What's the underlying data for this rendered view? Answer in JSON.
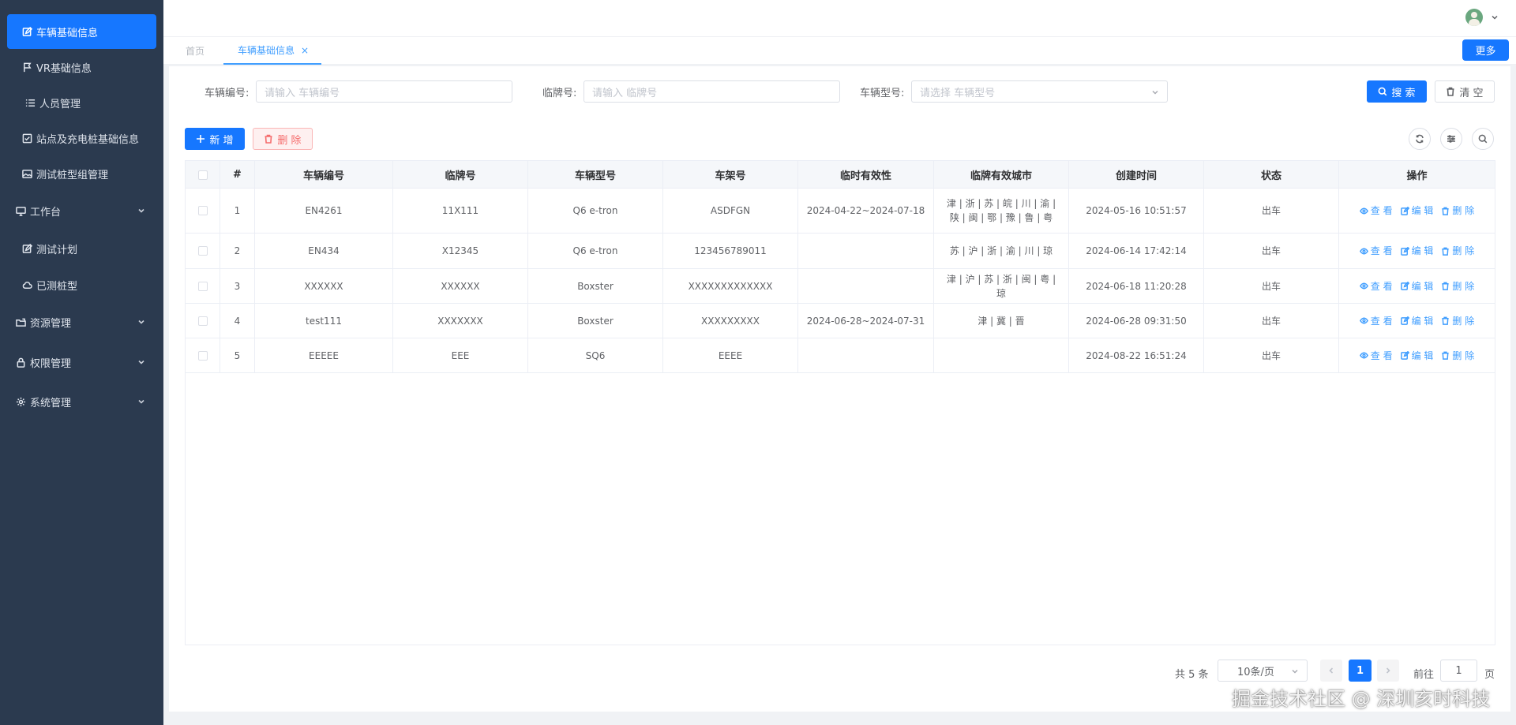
{
  "sidebar": {
    "items": [
      {
        "label": "车辆基础信息",
        "icon": "edit-icon",
        "active": true
      },
      {
        "label": "VR基础信息",
        "icon": "flag-icon"
      },
      {
        "label": "人员管理",
        "icon": "list-icon"
      },
      {
        "label": "站点及充电桩基础信息",
        "icon": "checkbox-icon"
      },
      {
        "label": "测试桩型组管理",
        "icon": "image-icon"
      },
      {
        "label": "工作台",
        "icon": "monitor-icon",
        "expandable": true
      },
      {
        "label": "测试计划",
        "icon": "edit-icon"
      },
      {
        "label": "已测桩型",
        "icon": "cloud-icon"
      },
      {
        "label": "资源管理",
        "icon": "folder-icon",
        "expandable": true
      },
      {
        "label": "权限管理",
        "icon": "lock-icon",
        "expandable": true
      },
      {
        "label": "系统管理",
        "icon": "gear-icon",
        "expandable": true
      }
    ]
  },
  "tabs": {
    "home": "首页",
    "active": "车辆基础信息",
    "close": "×",
    "more": "更多"
  },
  "filters": {
    "vehicle_no": {
      "label": "车辆编号:",
      "placeholder": "请输入 车辆编号"
    },
    "plate": {
      "label": "临牌号:",
      "placeholder": "请输入 临牌号"
    },
    "model": {
      "label": "车辆型号:",
      "placeholder": "请选择 车辆型号"
    },
    "search": "搜 索",
    "clear": "清 空"
  },
  "toolbar": {
    "add": "新 增",
    "delete": "删 除"
  },
  "table": {
    "headers": [
      "#",
      "车辆编号",
      "临牌号",
      "车辆型号",
      "车架号",
      "临时有效性",
      "临牌有效城市",
      "创建时间",
      "状态",
      "操作"
    ],
    "rows": [
      {
        "idx": "1",
        "vehicle_no": "EN4261",
        "plate": "11X111",
        "model": "Q6 e-tron",
        "vin": "ASDFGN",
        "validity": "2024-04-22~2024-07-18",
        "cities": "津 | 浙 | 苏 | 皖 | 川 | 渝 | 陕 | 闽 | 鄂 | 豫 | 鲁 | 粤",
        "created": "2024-05-16 10:51:57",
        "status": "出车"
      },
      {
        "idx": "2",
        "vehicle_no": "EN434",
        "plate": "X12345",
        "model": "Q6 e-tron",
        "vin": "123456789011",
        "validity": "",
        "cities": "苏 | 沪 | 浙 | 渝 | 川 | 琼",
        "created": "2024-06-14 17:42:14",
        "status": "出车"
      },
      {
        "idx": "3",
        "vehicle_no": "XXXXXX",
        "plate": "XXXXXX",
        "model": "Boxster",
        "vin": "XXXXXXXXXXXXX",
        "validity": "",
        "cities": "津 | 沪 | 苏 | 浙 | 闽 | 粤 | 琼",
        "created": "2024-06-18 11:20:28",
        "status": "出车"
      },
      {
        "idx": "4",
        "vehicle_no": "test111",
        "plate": "XXXXXXX",
        "model": "Boxster",
        "vin": "XXXXXXXXX",
        "validity": "2024-06-28~2024-07-31",
        "cities": "津 | 冀 | 晋",
        "created": "2024-06-28 09:31:50",
        "status": "出车"
      },
      {
        "idx": "5",
        "vehicle_no": "EEEEE",
        "plate": "EEE",
        "model": "SQ6",
        "vin": "EEEE",
        "validity": "",
        "cities": "",
        "created": "2024-08-22 16:51:24",
        "status": "出车"
      }
    ],
    "actions": {
      "view": "查 看",
      "edit": "编 辑",
      "delete": "删 除"
    }
  },
  "pagination": {
    "total": "共 5 条",
    "page_size": "10条/页",
    "current": "1",
    "goto_prefix": "前往",
    "goto_value": "1",
    "goto_suffix": "页"
  },
  "watermark": "掘金技术社区 @ 深圳亥时科技",
  "colors": {
    "primary": "#1677ff",
    "sidebar": "#2b3a4f",
    "link": "#409eff",
    "danger": "#f56c6c"
  }
}
